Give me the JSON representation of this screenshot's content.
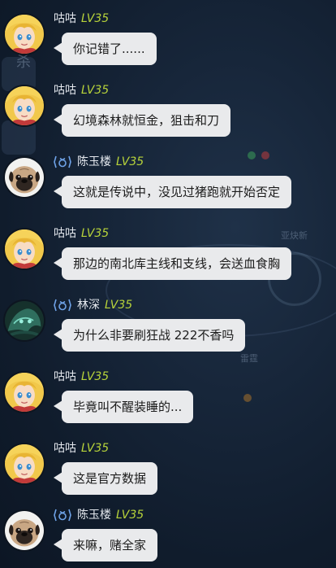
{
  "messages": [
    {
      "user": "咕咕",
      "level": "LV35",
      "text": "你记错了......",
      "avatar": "blonde-girl-avatar",
      "badge": false
    },
    {
      "user": "咕咕",
      "level": "LV35",
      "text": "幻境森林就恒金，狙击和刀",
      "avatar": "blonde-girl-avatar",
      "badge": false
    },
    {
      "user": "陈玉楼",
      "level": "LV35",
      "text": "这就是传说中，没见过猪跑就开始否定",
      "avatar": "pug-avatar",
      "badge": true
    },
    {
      "user": "咕咕",
      "level": "LV35",
      "text": "那边的南北库主线和支线，会送血食胸",
      "avatar": "blonde-girl-avatar",
      "badge": false
    },
    {
      "user": "林深",
      "level": "LV35",
      "text": "为什么非要刷狂战 222不香吗",
      "avatar": "dark-creature-avatar",
      "badge": true
    },
    {
      "user": "咕咕",
      "level": "LV35",
      "text": "毕竟叫不醒装睡的...",
      "avatar": "blonde-girl-avatar",
      "badge": false
    },
    {
      "user": "咕咕",
      "level": "LV35",
      "text": "这是官方数据",
      "avatar": "blonde-girl-avatar",
      "badge": false
    },
    {
      "user": "陈玉楼",
      "level": "LV35",
      "text": "来嘛，赌全家",
      "avatar": "pug-avatar",
      "badge": true
    }
  ],
  "background_labels": {
    "label_1": "杀",
    "label_2": "亚炔新",
    "label_3": "雷霆"
  },
  "colors": {
    "level": "#b8d43a",
    "username": "#e4e8ee",
    "bubble": "#e9eaec",
    "badge": "#6fa3e8"
  }
}
